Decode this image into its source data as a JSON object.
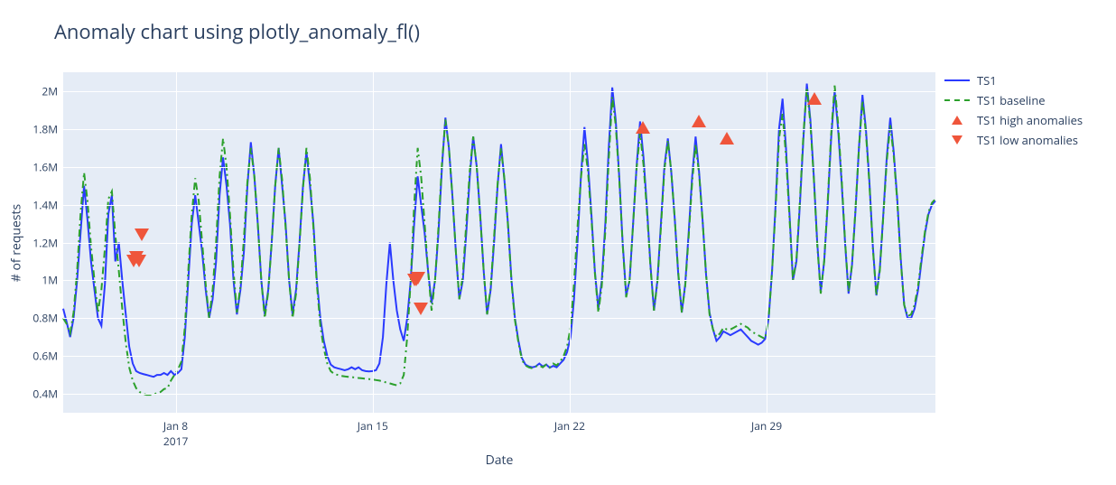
{
  "chart_data": {
    "type": "line",
    "title": "Anomaly chart using plotly_anomaly_fl()",
    "xlabel": "Date",
    "ylabel": "# of requests",
    "x_range_days": [
      0,
      31
    ],
    "x_ticks": [
      {
        "day": 4,
        "label": "Jan 8",
        "year": "2017"
      },
      {
        "day": 11,
        "label": "Jan 15",
        "year": ""
      },
      {
        "day": 18,
        "label": "Jan 22",
        "year": ""
      },
      {
        "day": 25,
        "label": "Jan 29",
        "year": ""
      }
    ],
    "y_ticks": [
      {
        "v": 400000,
        "label": "0.4M"
      },
      {
        "v": 600000,
        "label": "0.6M"
      },
      {
        "v": 800000,
        "label": "0.8M"
      },
      {
        "v": 1000000,
        "label": "1M"
      },
      {
        "v": 1200000,
        "label": "1.2M"
      },
      {
        "v": 1400000,
        "label": "1.4M"
      },
      {
        "v": 1600000,
        "label": "1.6M"
      },
      {
        "v": 1800000,
        "label": "1.8M"
      },
      {
        "v": 2000000,
        "label": "2M"
      }
    ],
    "ylim": [
      300000,
      2100000
    ],
    "legend": {
      "ts1": "TS1",
      "baseline": "TS1 baseline",
      "high": "TS1 high anomalies",
      "low": "TS1 low anomalies"
    },
    "series": [
      {
        "name": "TS1",
        "class": "ts1",
        "values_by_quarter_day": [
          850000,
          780000,
          700000,
          800000,
          1000000,
          1250000,
          1500000,
          1320000,
          1100000,
          950000,
          800000,
          760000,
          980000,
          1350000,
          1450000,
          1100000,
          1200000,
          1000000,
          820000,
          650000,
          560000,
          520000,
          510000,
          505000,
          500000,
          495000,
          490000,
          500000,
          500000,
          510000,
          500000,
          520000,
          500000,
          510000,
          530000,
          700000,
          1000000,
          1300000,
          1450000,
          1300000,
          1150000,
          950000,
          800000,
          900000,
          1100000,
          1450000,
          1650000,
          1500000,
          1300000,
          1000000,
          820000,
          950000,
          1150000,
          1500000,
          1730000,
          1550000,
          1300000,
          1000000,
          820000,
          950000,
          1200000,
          1500000,
          1700000,
          1500000,
          1300000,
          1000000,
          820000,
          950000,
          1200000,
          1500000,
          1680000,
          1500000,
          1300000,
          1000000,
          800000,
          680000,
          600000,
          555000,
          540000,
          535000,
          530000,
          525000,
          530000,
          540000,
          530000,
          540000,
          525000,
          520000,
          518000,
          520000,
          525000,
          560000,
          700000,
          980000,
          1200000,
          1000000,
          840000,
          740000,
          680000,
          800000,
          1000000,
          1300000,
          1550000,
          1400000,
          1250000,
          1050000,
          880000,
          1000000,
          1250000,
          1600000,
          1860000,
          1700000,
          1450000,
          1150000,
          900000,
          1000000,
          1250000,
          1550000,
          1760000,
          1600000,
          1350000,
          1050000,
          820000,
          950000,
          1200000,
          1500000,
          1720000,
          1520000,
          1300000,
          1000000,
          800000,
          680000,
          590000,
          555000,
          545000,
          540000,
          545000,
          560000,
          545000,
          555000,
          538000,
          548000,
          540000,
          560000,
          580000,
          620000,
          700000,
          900000,
          1200000,
          1550000,
          1810000,
          1620000,
          1350000,
          1050000,
          850000,
          1000000,
          1300000,
          1700000,
          2020000,
          1850000,
          1550000,
          1200000,
          920000,
          1000000,
          1300000,
          1600000,
          1840000,
          1650000,
          1380000,
          1080000,
          840000,
          1000000,
          1300000,
          1600000,
          1750000,
          1570000,
          1320000,
          1030000,
          830000,
          980000,
          1250000,
          1550000,
          1760000,
          1570000,
          1320000,
          1030000,
          830000,
          740000,
          680000,
          700000,
          730000,
          720000,
          710000,
          720000,
          730000,
          740000,
          720000,
          700000,
          680000,
          670000,
          660000,
          670000,
          690000,
          800000,
          1050000,
          1400000,
          1800000,
          1960000,
          1700000,
          1350000,
          1000000,
          1100000,
          1400000,
          1750000,
          2040000,
          1850000,
          1550000,
          1200000,
          940000,
          1100000,
          1400000,
          1750000,
          2000000,
          1800000,
          1520000,
          1200000,
          930000,
          1080000,
          1370000,
          1700000,
          1980000,
          1800000,
          1520000,
          1180000,
          920000,
          1060000,
          1350000,
          1650000,
          1860000,
          1680000,
          1430000,
          1120000,
          870000,
          800000,
          800000,
          850000,
          950000,
          1100000,
          1250000,
          1350000,
          1400000,
          1420000
        ]
      },
      {
        "name": "TS1 baseline",
        "class": "baseline",
        "values_by_quarter_day": [
          800000,
          770000,
          720000,
          830000,
          1050000,
          1350000,
          1570000,
          1420000,
          1180000,
          1000000,
          830000,
          950000,
          1170000,
          1430000,
          1470000,
          1240000,
          1050000,
          850000,
          670000,
          540000,
          470000,
          430000,
          410000,
          400000,
          395000,
          395000,
          395000,
          405000,
          410000,
          425000,
          430000,
          470000,
          500000,
          528000,
          570000,
          750000,
          1050000,
          1350000,
          1540000,
          1420000,
          1200000,
          980000,
          800000,
          950000,
          1200000,
          1550000,
          1750000,
          1600000,
          1350000,
          1050000,
          830000,
          970000,
          1220000,
          1520000,
          1700000,
          1550000,
          1300000,
          1000000,
          800000,
          940000,
          1200000,
          1500000,
          1700000,
          1530000,
          1280000,
          1000000,
          800000,
          930000,
          1190000,
          1490000,
          1700000,
          1540000,
          1280000,
          980000,
          760000,
          640000,
          560000,
          520000,
          505000,
          500000,
          495000,
          492000,
          490000,
          488000,
          486000,
          484000,
          482000,
          480000,
          478000,
          476000,
          473000,
          470000,
          465000,
          460000,
          455000,
          450000,
          445000,
          455000,
          500000,
          700000,
          1000000,
          1400000,
          1700000,
          1550000,
          1300000,
          1050000,
          840000,
          1000000,
          1280000,
          1620000,
          1850000,
          1700000,
          1450000,
          1150000,
          900000,
          1030000,
          1300000,
          1580000,
          1760000,
          1600000,
          1340000,
          1050000,
          820000,
          960000,
          1230000,
          1510000,
          1700000,
          1530000,
          1290000,
          990000,
          790000,
          670000,
          580000,
          550000,
          540000,
          535000,
          545000,
          550000,
          540000,
          555000,
          540000,
          560000,
          550000,
          570000,
          600000,
          650000,
          750000,
          980000,
          1280000,
          1540000,
          1720000,
          1580000,
          1330000,
          1040000,
          830000,
          970000,
          1260000,
          1640000,
          1970000,
          1820000,
          1540000,
          1190000,
          910000,
          1000000,
          1300000,
          1590000,
          1780000,
          1610000,
          1360000,
          1070000,
          840000,
          990000,
          1280000,
          1580000,
          1740000,
          1570000,
          1320000,
          1040000,
          830000,
          970000,
          1230000,
          1520000,
          1720000,
          1560000,
          1320000,
          1030000,
          820000,
          740000,
          700000,
          720000,
          750000,
          740000,
          740000,
          750000,
          760000,
          770000,
          760000,
          750000,
          730000,
          720000,
          710000,
          700000,
          690000,
          800000,
          1050000,
          1380000,
          1750000,
          1880000,
          1660000,
          1330000,
          1000000,
          1110000,
          1420000,
          1770000,
          2020000,
          1830000,
          1540000,
          1190000,
          930000,
          1100000,
          1420000,
          1770000,
          2030000,
          1830000,
          1540000,
          1210000,
          940000,
          1080000,
          1380000,
          1700000,
          1950000,
          1780000,
          1510000,
          1170000,
          920000,
          1050000,
          1340000,
          1630000,
          1820000,
          1660000,
          1420000,
          1110000,
          870000,
          810000,
          820000,
          870000,
          970000,
          1120000,
          1260000,
          1360000,
          1410000,
          1430000
        ]
      }
    ],
    "high_anomalies": [
      {
        "day": 20.6,
        "v": 1810000
      },
      {
        "day": 22.6,
        "v": 1840000
      },
      {
        "day": 23.6,
        "v": 1750000
      },
      {
        "day": 26.7,
        "v": 1960000
      }
    ],
    "low_anomalies": [
      {
        "day": 2.5,
        "v": 1100000
      },
      {
        "day": 2.6,
        "v": 1120000
      },
      {
        "day": 2.7,
        "v": 1100000
      },
      {
        "day": 2.8,
        "v": 1240000
      },
      {
        "day": 12.48,
        "v": 1000000
      },
      {
        "day": 12.55,
        "v": 1000000
      },
      {
        "day": 12.62,
        "v": 1010000
      },
      {
        "day": 12.7,
        "v": 850000
      }
    ]
  }
}
